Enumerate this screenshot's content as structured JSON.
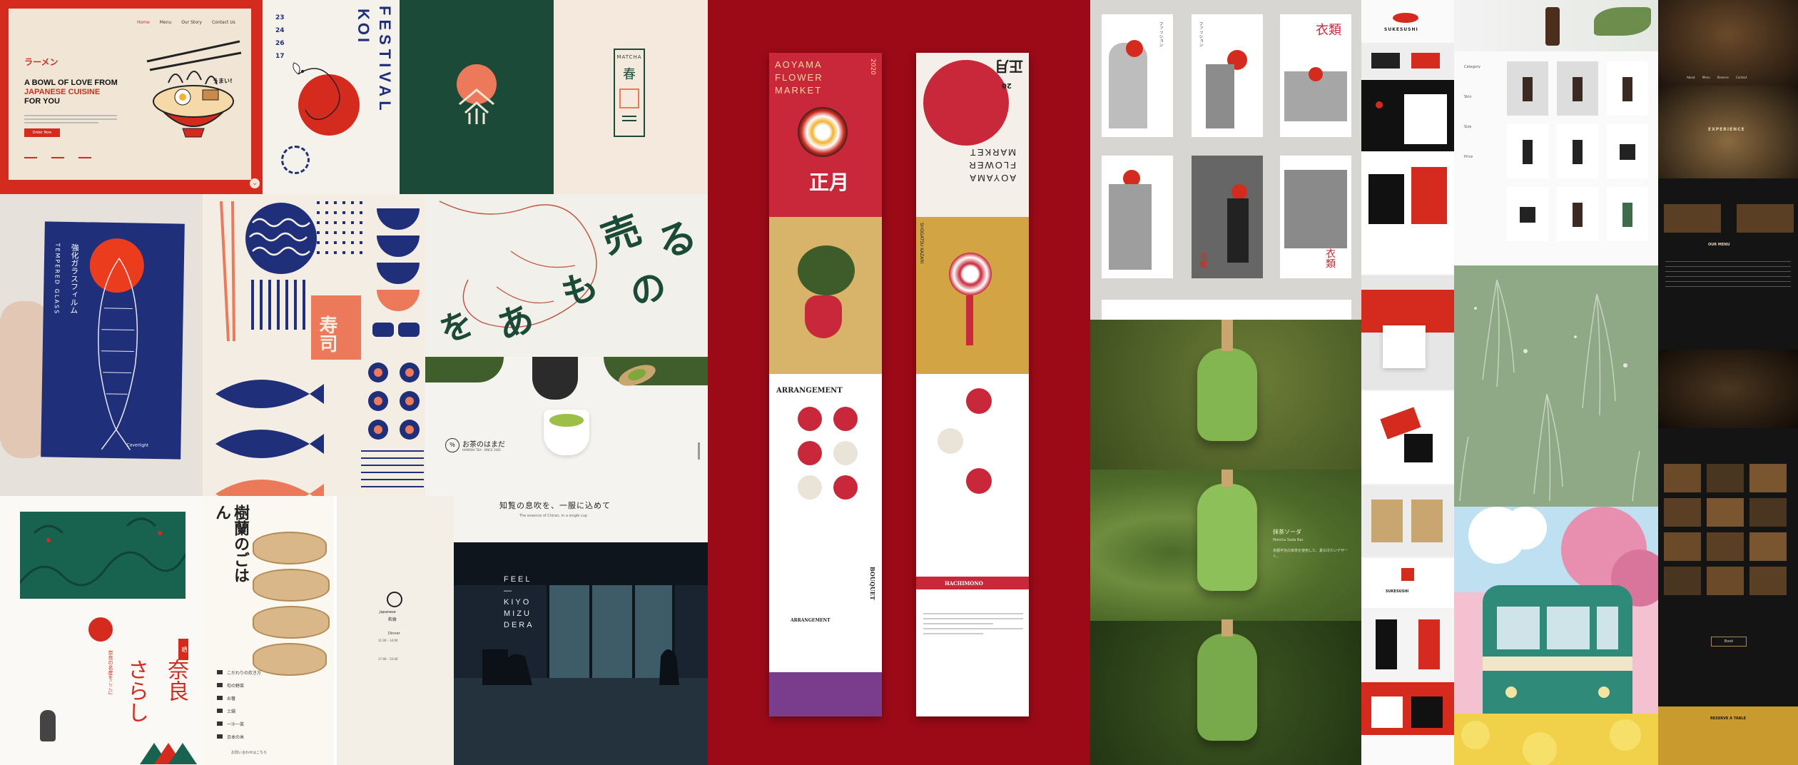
{
  "colors": {
    "red": "#d42b1e",
    "dark_red": "#9c0a17",
    "green": "#1c4a39",
    "navy": "#1f2f7a",
    "cream": "#f1e6d6",
    "orange": "#ec7a5a",
    "matcha": "#6c8a3c",
    "sage": "#8fa886",
    "black": "#121212"
  },
  "ramen": {
    "nav": [
      "Home",
      "Menu",
      "Our Story",
      "Contact Us"
    ],
    "kana": "ラーメン",
    "headline_1": "A BOWL OF LOVE FROM",
    "headline_2": "JAPANESE CUISINE",
    "headline_3": "FOR YOU",
    "umai": "うまい!",
    "button": "Order Now"
  },
  "koi": {
    "dates": [
      "23",
      "24",
      "26",
      "17"
    ],
    "title_1": "KOI",
    "title_2": "FESTIVAL"
  },
  "matcha_logo": {
    "label": "MATCHA",
    "kanji": "春"
  },
  "fish_glass": {
    "side_text": "TEMPERED GLASS",
    "jp": "強化ガラスフィルム",
    "brand": "Coverlight"
  },
  "sushi": {
    "kanji": "寿司"
  },
  "jp_poster": {
    "chars": [
      "る",
      "の",
      "売",
      "も",
      "あ",
      "を"
    ]
  },
  "tea": {
    "brand": "お茶のはまだ",
    "sub": "HAMADA TEA · SINCE 1945",
    "tagline": "知覧の息吹を、一服に込めて",
    "tagline_en": "The essence of Chiran, in a single cup"
  },
  "nara": {
    "title": "奈良",
    "title2": "さらし",
    "sub": "奈良の名産をここに",
    "stamp": "晒"
  },
  "gohan": {
    "title": "樹蘭のごはん",
    "list": [
      "こだわりの炊き方",
      "旬の野菜",
      "お箸",
      "土鍋",
      "一汁一菜",
      "日本の米"
    ],
    "note": "お問い合わせはこちら"
  },
  "japanese_card": {
    "brand": "Japanese",
    "name": "和食",
    "text": "Dinner",
    "hours_1": "11:00 – 14:00",
    "hours_2": "17:00 – 22:00"
  },
  "kiyomizu": {
    "lines": [
      "FEEL",
      "—",
      "KIYO",
      "MIZU",
      "DERA"
    ]
  },
  "flower_market": {
    "brand": "AOYAMA FLOWER MARKET",
    "year": "2020",
    "kanji": "正月",
    "section_1": "ARRANGEMENT",
    "section_2": "BOUQUET",
    "section_3": "HACHIMONO",
    "section_4": "ARRANGEMENT",
    "kazari": "SHOGATSU KAZARI",
    "label_20": "20"
  },
  "fashion": {
    "title_1": "衣類",
    "title_2": "衣類",
    "kyoto": "京都",
    "vertical": "ファッション"
  },
  "matcha_bar": {
    "title": "抹茶ソーダ",
    "sub": "Matcha Soda Bar",
    "copy": "京都宇治の抹茶を使用した、夏の冷たいデザート。"
  },
  "sukesushi": {
    "brand": "SUKESUSHI",
    "bag": "SUKESUSHI"
  },
  "skincare": {
    "filters": [
      "Category",
      "Skin",
      "Size",
      "Price"
    ]
  },
  "restaurant": {
    "nav": [
      "About",
      "Menu",
      "Reserve",
      "Contact"
    ],
    "hero": "EXPERIENCE",
    "menu_title": "OUR MENU",
    "footer": "RESERVE A TABLE",
    "cta": "Book"
  }
}
